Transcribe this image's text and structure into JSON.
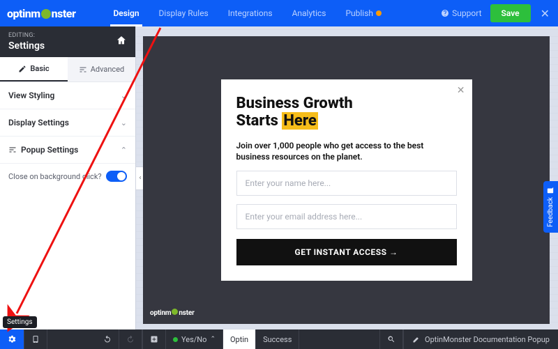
{
  "brand": "optinmonster",
  "nav": {
    "design": "Design",
    "display_rules": "Display Rules",
    "integrations": "Integrations",
    "analytics": "Analytics",
    "publish": "Publish"
  },
  "top": {
    "support": "Support",
    "save": "Save"
  },
  "sidebar": {
    "editing_label": "EDITING:",
    "title": "Settings",
    "tabs": {
      "basic": "Basic",
      "advanced": "Advanced"
    },
    "sections": {
      "view_styling": "View Styling",
      "display_settings": "Display Settings",
      "popup_settings": "Popup Settings"
    },
    "close_bg_label": "Close on background click?"
  },
  "popup": {
    "headline_line1": "Business Growth",
    "headline_line2_pre": "Starts ",
    "headline_line2_hl": "Here",
    "sub": "Join over 1,000 people who get access to the best business resources on the planet.",
    "name_ph": "Enter your name here...",
    "email_ph": "Enter your email address here...",
    "cta": "GET INSTANT ACCESS →"
  },
  "canvas_brand": "optinmonster",
  "feedback": "Feedback",
  "bottom": {
    "yes_no": "Yes/No",
    "optin": "Optin",
    "success": "Success",
    "doc_title": "OptinMonster Documentation Popup",
    "settings_tooltip": "Settings"
  }
}
